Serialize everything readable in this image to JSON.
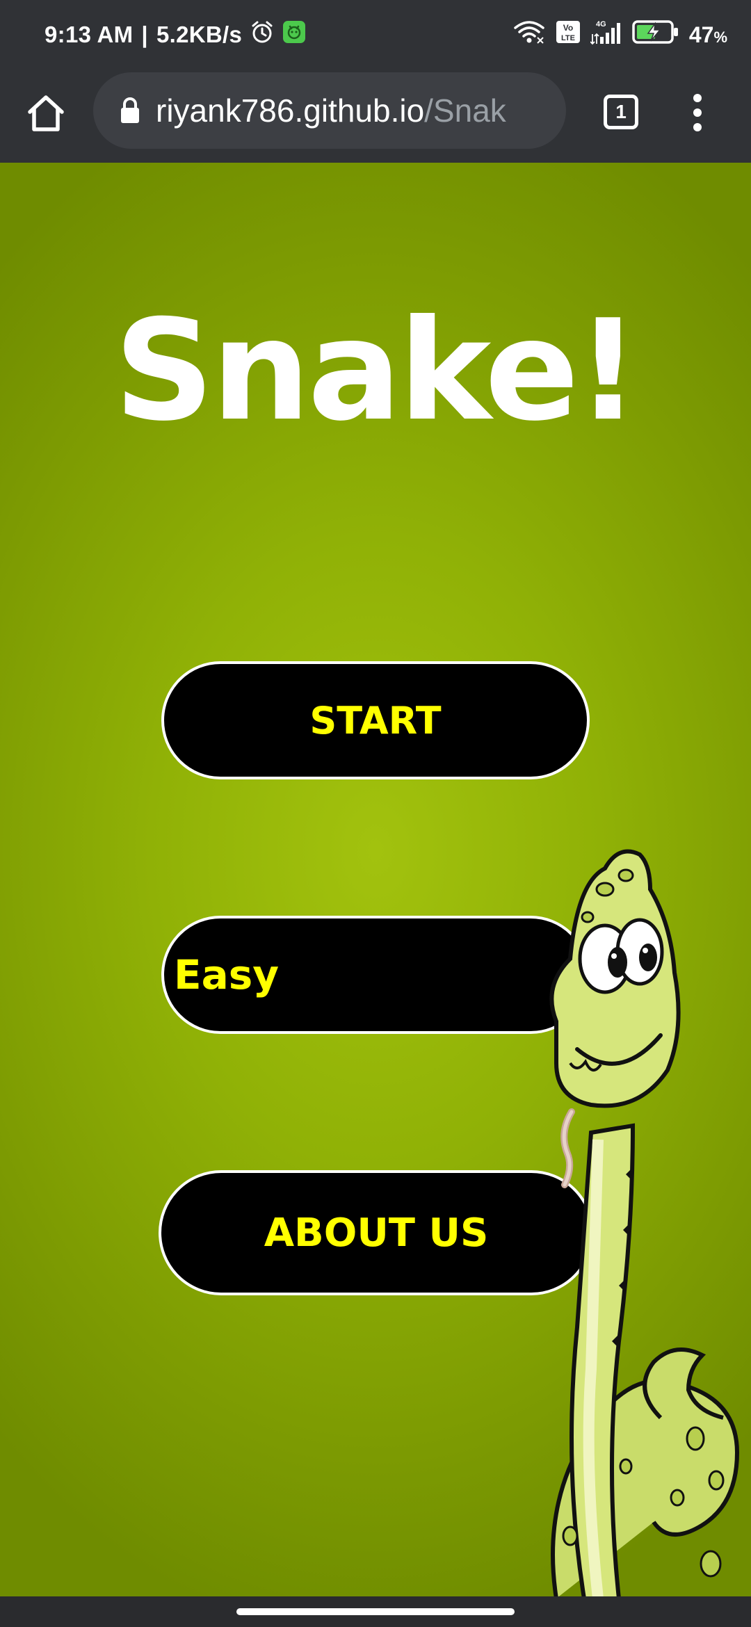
{
  "status_bar": {
    "time": "9:13 AM",
    "separator": "|",
    "network_speed": "5.2KB/s",
    "network_type": "4G",
    "volte_badge": "Vo LTE",
    "battery_percent": "47",
    "battery_percent_symbol": "%",
    "battery_level": 0.47,
    "icons": [
      "alarm-icon",
      "notification-app-icon",
      "wifi-icon",
      "volte-icon",
      "signal-icon",
      "battery-charging-icon"
    ]
  },
  "browser": {
    "url_host": "riyank786.github.io",
    "url_path": "/Snak",
    "tab_count": "1",
    "icons": [
      "home-icon",
      "lock-icon",
      "tabs-icon",
      "overflow-menu-icon"
    ]
  },
  "page": {
    "title": "Snake!",
    "start_label": "START",
    "difficulty_selected": "Easy",
    "about_label": "ABOUT US"
  },
  "colors": {
    "background_green": "#8fb006",
    "button_bg": "#000000",
    "button_text": "#ffff00",
    "button_border": "#ffffff",
    "title_color": "#ffffff",
    "browser_chrome": "#303236"
  }
}
